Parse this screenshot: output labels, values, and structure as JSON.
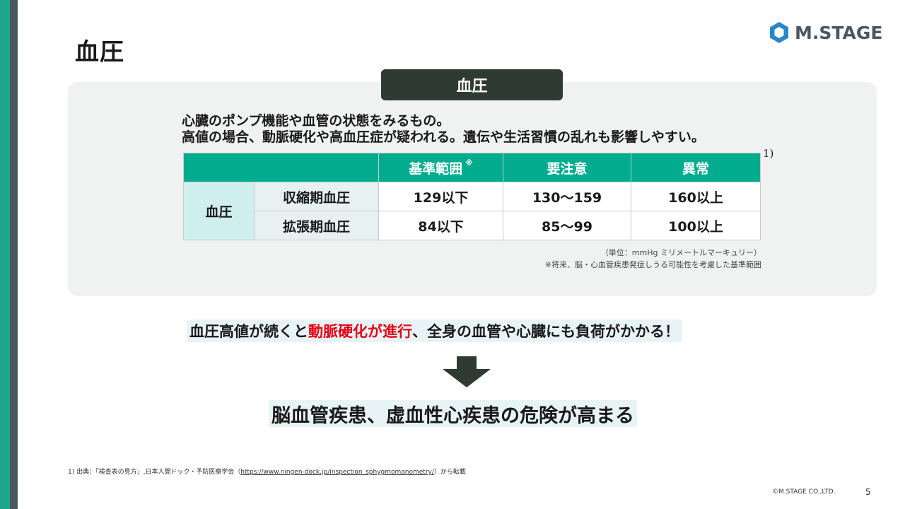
{
  "slide": {
    "title": "血圧",
    "page_number": "5",
    "copyright": "©M.STAGE CO.,LTD."
  },
  "logo": {
    "text": "M.STAGE",
    "icon": "hexagon-logo-icon"
  },
  "panel": {
    "header": "血圧",
    "description": [
      "心臓のポンプ機能や血管の状態をみるもの。",
      "高値の場合、動脈硬化や高血圧症が疑われる。遺伝や生活習慣の乱れも影響しやすい。"
    ],
    "reference_mark": "1)",
    "table": {
      "headers": [
        "",
        "基準範囲",
        "要注意",
        "異常"
      ],
      "header_note": "※",
      "category": "血圧",
      "rows": [
        {
          "label": "収縮期血圧",
          "values": [
            "129以下",
            "130～159",
            "160以上"
          ]
        },
        {
          "label": "拡張期血圧",
          "values": [
            "84以下",
            "85～99",
            "100以上"
          ]
        }
      ]
    },
    "unit_note": "（単位：mmHg ミリメートルマーキュリー）",
    "range_note": "※将来、脳・心血管疾患発症しうる可能性を考慮した基準範囲"
  },
  "claim": {
    "before": "血圧高値が続くと",
    "highlight": "動脈硬化が進行",
    "after": "、全身の血管や心臓にも負荷がかかる！",
    "highlight_color": "#e60012"
  },
  "conclusion": "脳血管疾患、虚血性心疾患の危険が高まる",
  "footnote": {
    "prefix": "1) 出典：「検査表の見方」,日本人間ドック・予防医療学会（",
    "link": "https://www.ningen-dock.jp/inspection_sphygmomanometry/",
    "suffix": "）から転載"
  },
  "colors": {
    "accent": "#00ab8e",
    "sidebar": "#1fa58c",
    "header_dark": "#2e3a32",
    "logo_gray": "#4b5860"
  }
}
